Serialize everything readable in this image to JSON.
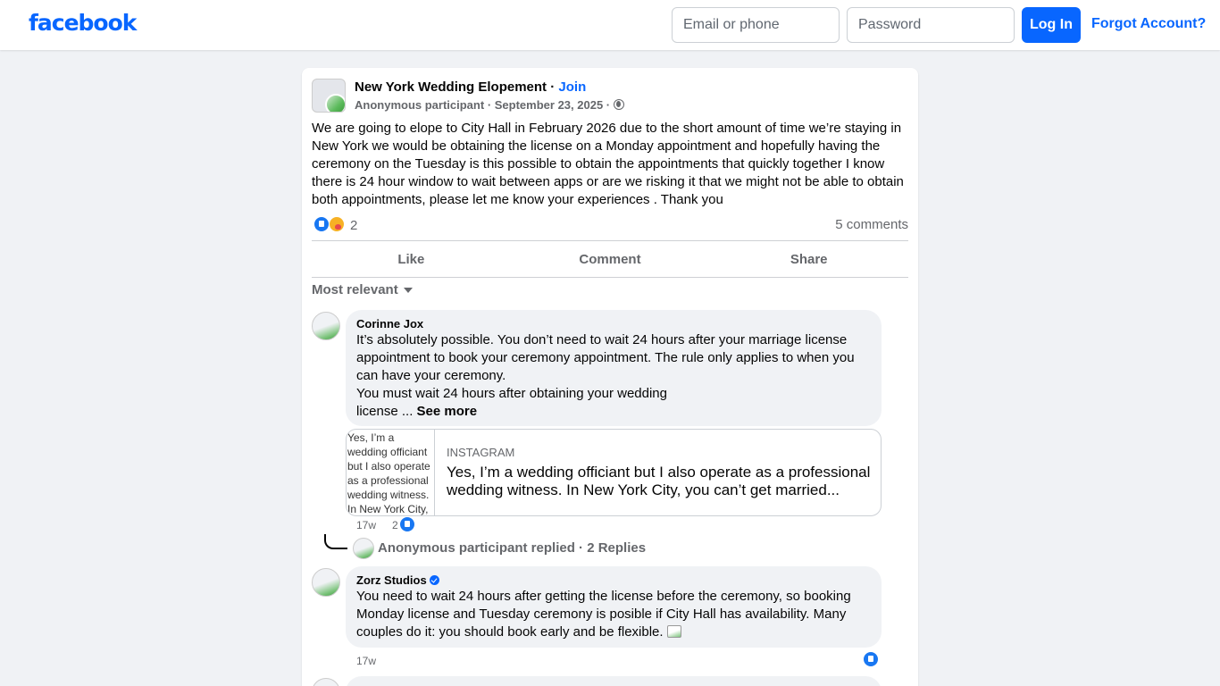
{
  "header": {
    "logo": "facebook",
    "email_placeholder": "Email or phone",
    "password_placeholder": "Password",
    "login_label": "Log In",
    "forgot_label": "Forgot Account?"
  },
  "post": {
    "group_name": "New York Wedding Elopement",
    "join_label": "Join",
    "author": "Anonymous participant",
    "date": "September 23, 2025",
    "text": "We are going to elope to City Hall in February 2026 due to the short amount of time we’re staying in New York we would be obtaining the license on a Monday appointment and hopefully having the ceremony on the Tuesday is this possible to obtain the appointments that quickly together I know there is 24 hour window to wait between apps or are we risking it that we might not be able to obtain both appointments, please let me know your experiences . Thank you",
    "reaction_count": "2",
    "comments_count": "5 comments",
    "actions": {
      "like": "Like",
      "comment": "Comment",
      "share": "Share"
    },
    "sort_label": "Most relevant"
  },
  "comments": [
    {
      "author": "Corinne Jox",
      "text_line1": "It’s absolutely possible. You don’t need to wait 24 hours after your marriage license appointment to book your ceremony appointment. The rule only applies to when you can have your ceremony.",
      "text_line2": "You must wait 24 hours after obtaining your wedding license ...",
      "see_more": "See more",
      "link": {
        "thumb_alt": "Yes, I’m a wedding officiant but I also operate as a professional wedding witness. In New York City,",
        "source": "INSTAGRAM",
        "title": "Yes, I’m a wedding officiant but I also operate as a professional wedding witness. In New York City, you can’t get married..."
      },
      "age": "17w",
      "likes": "2",
      "replies": "Anonymous participant replied · 2 Replies"
    },
    {
      "author": "Zorz Studios",
      "text": "You need to wait 24 hours after getting the license before the ceremony, so booking Monday license and Tuesday ceremony is posible if City Hall has availability. Many couples do it: you should book early and be flexible.",
      "age": "17w"
    }
  ]
}
